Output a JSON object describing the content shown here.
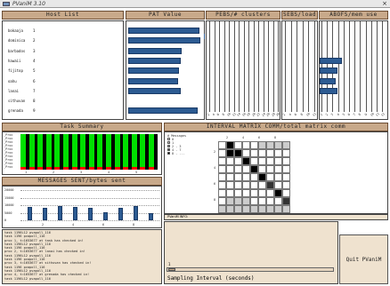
{
  "window": {
    "title": "PVaniM 3.10",
    "close_glyph": "×"
  },
  "headers": {
    "host_list": "Host List",
    "pat_value": "PAT Value",
    "pebs_clusters": "PEBS/# clusters",
    "sebs_load": "SEBS/load",
    "abofs_mem": "ABOFS/mem use",
    "task_summary": "Task Summary",
    "interval_matrix": "INTERVAL MATRIX COMM/total matrix comm",
    "messages": "MESSAGES SENT/bytes sent"
  },
  "hosts": [
    {
      "name": "bokaaja",
      "num": "1"
    },
    {
      "name": "dominica",
      "num": "2"
    },
    {
      "name": "barbados",
      "num": "3"
    },
    {
      "name": "hawaii",
      "num": "4"
    },
    {
      "name": "fijitop",
      "num": "5"
    },
    {
      "name": "oahu",
      "num": "6"
    },
    {
      "name": "lanai",
      "num": "7"
    },
    {
      "name": "sithuvan",
      "num": "8"
    },
    {
      "name": "grenada",
      "num": "9"
    }
  ],
  "pat_values": [
    0.95,
    0.97,
    0.72,
    0.7,
    0.68,
    0.67,
    0.7,
    0.0,
    0.93
  ],
  "abofs_values": [
    0,
    0,
    0,
    0.95,
    0.75,
    0.7,
    0.75,
    0,
    0
  ],
  "cluster_ticks": [
    "2",
    "4",
    "6",
    "8",
    "10",
    "12",
    "14",
    "16",
    "18",
    "20",
    "22",
    "24",
    "26",
    "28",
    "30"
  ],
  "task_summary": {
    "labels": [
      "_Proc",
      "_Proc",
      "_Proc",
      "_Proc",
      "_Proc",
      "_Proc",
      "_Proc",
      "_Proc",
      "_Proc",
      "_Proc"
    ],
    "xticks": [
      "1",
      "2",
      "3",
      "4",
      "5"
    ],
    "colors": {
      "busy": "#00e000",
      "comm": "#ff0000",
      "idle": "#000000"
    }
  },
  "messages": {
    "yticks": [
      "20000",
      "15000",
      "10000",
      "5000",
      "0"
    ],
    "xticks": [
      "2",
      "4",
      "6",
      "8"
    ],
    "values": [
      9000,
      8500,
      9500,
      9000,
      8000,
      5500,
      8500,
      9500,
      5000
    ]
  },
  "matrix": {
    "legend_title": "# Messages",
    "legend": [
      "0",
      "1",
      "2 - 3",
      "4 - 7",
      "8 - ..."
    ],
    "xticks": [
      "2",
      "4",
      "6",
      "8"
    ],
    "yticks": [
      "2",
      "4",
      "6",
      "8"
    ],
    "status": "PVaniM INFO:"
  },
  "log": [
    "task 1196L12 pvapoll_116",
    "task 1196 pvapoll_116",
    "proc 1, t=1653677 at task has checked in!",
    "task 1196L12 pvapoll_116",
    "task 1196 pvapoll_116",
    "proc 2, t=1653677 at lanai has checked in!",
    "task 1196L12 pvapoll_116",
    "task 1196 pvapoll_116",
    "proc 3, t=1653677 at sithuvan has checked in!",
    "task 1196 pvapoll_116",
    "task 1196L12 pvapoll_116",
    "proc 4, t=1653677 at grenada has checked in!",
    "task 1196L12 pvapoll_116"
  ],
  "controls": {
    "quit_label": "Quit PVaniM",
    "slider_value": "1",
    "slider_label": "Sampling Interval (seconds)"
  }
}
